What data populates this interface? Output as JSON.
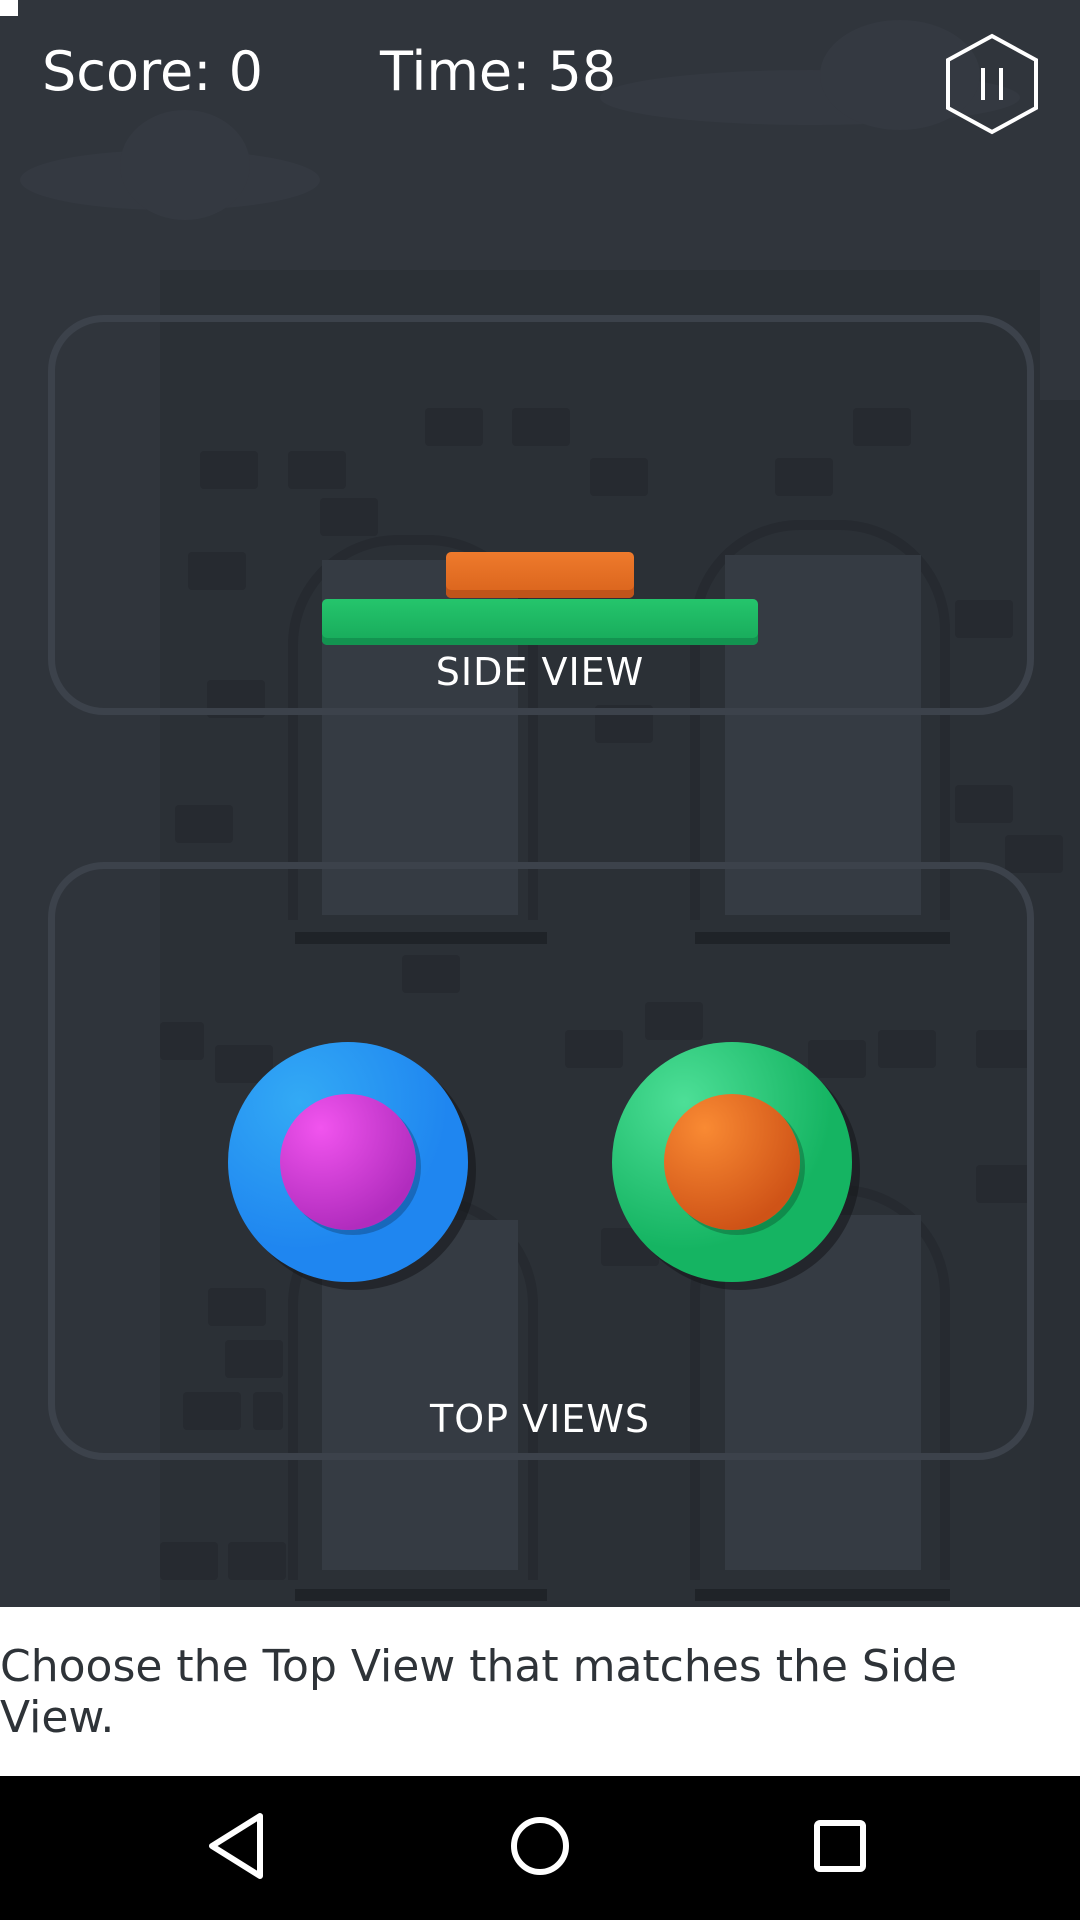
{
  "hud": {
    "score_label": "Score: 0",
    "time_label": "Time: 58",
    "pause_icon": "pause-hexagon-icon"
  },
  "side_view": {
    "label": "SIDE VIEW",
    "pieces": [
      {
        "name": "top-bar",
        "color": "#ea722a"
      },
      {
        "name": "bottom-bar",
        "color": "#1fbf68"
      }
    ]
  },
  "top_views": {
    "label": "TOP VIEWS",
    "options": [
      {
        "outer_color": "#1f86f0",
        "inner_color": "#d63fe0"
      },
      {
        "outer_color": "#1bc06f",
        "inner_color": "#ef7426"
      }
    ]
  },
  "instruction": "Choose the Top View that matches the Side View.",
  "nav": {
    "back_icon": "triangle-back-icon",
    "home_icon": "circle-home-icon",
    "recents_icon": "square-recents-icon"
  },
  "colors": {
    "background": "#2f343b",
    "frame": "#3c424b",
    "text_light": "#ffffff",
    "instruction_text": "#2e3338"
  }
}
